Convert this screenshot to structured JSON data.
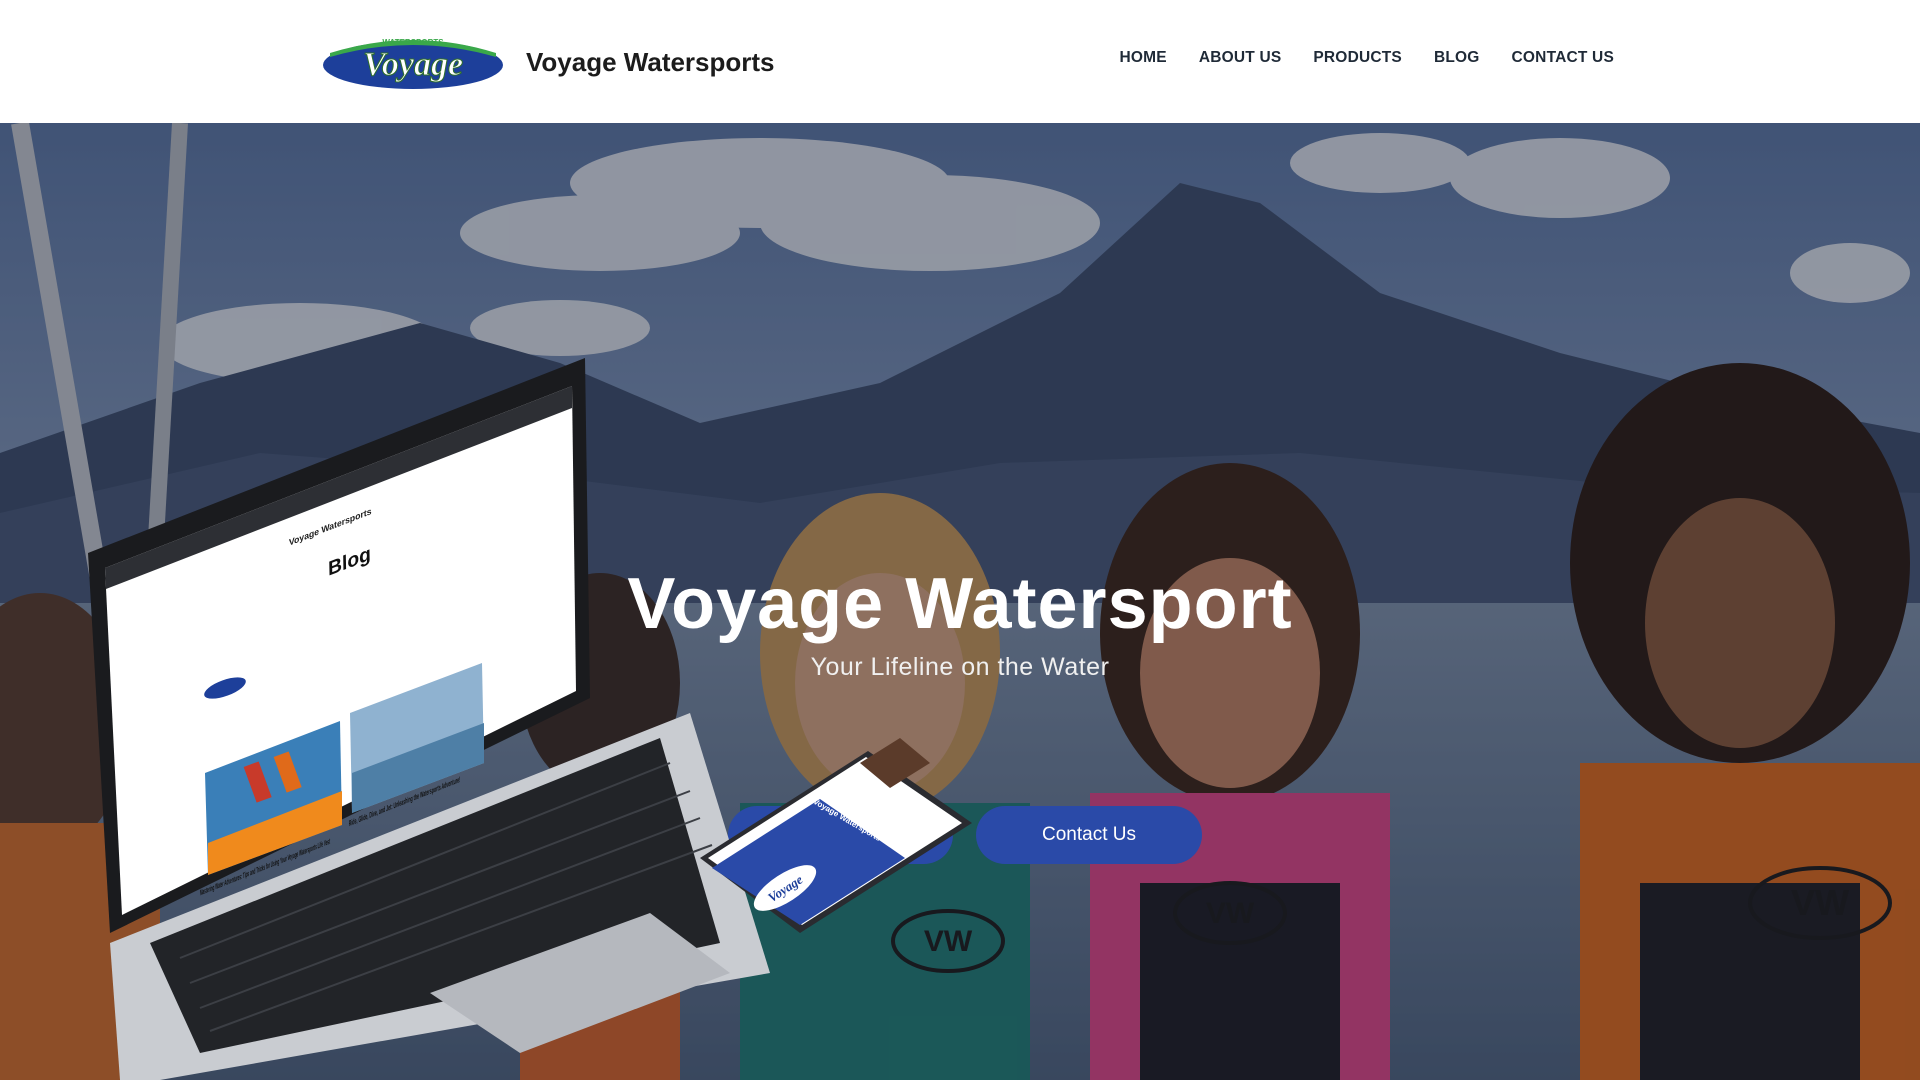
{
  "brand": {
    "logo_text": "Voyage",
    "logo_subtext": "WATERSPORTS",
    "name": "Voyage Watersports"
  },
  "nav": {
    "items": [
      {
        "label": "HOME"
      },
      {
        "label": "ABOUT US"
      },
      {
        "label": "PRODUCTS"
      },
      {
        "label": "BLOG"
      },
      {
        "label": "CONTACT US"
      }
    ]
  },
  "hero": {
    "title": "Voyage Watersport",
    "tagline": "Your Lifeline on the Water",
    "secondary_button": "",
    "contact_button": "Contact Us"
  },
  "laptop_mockup": {
    "site_name": "Voyage Watersports",
    "heading": "Blog",
    "post1_title": "Mastering Water Adventures: Tips and Tricks for Using Your Voyage Watersports Life Vest",
    "post2_title": "Ride, Glide, Dive, and Jet: Unleashing the Watersports Adventure!"
  },
  "phone_mockup": {
    "site_name": "Voyage Watersports",
    "logo_text": "Voyage"
  },
  "vest_print": "VW",
  "colors": {
    "accent": "#2a4aa8",
    "logo_blue": "#1d3f9a",
    "logo_green": "#3aa84a"
  },
  "icons": [
    "voyage-logo-icon",
    "laptop-icon",
    "phone-icon"
  ]
}
